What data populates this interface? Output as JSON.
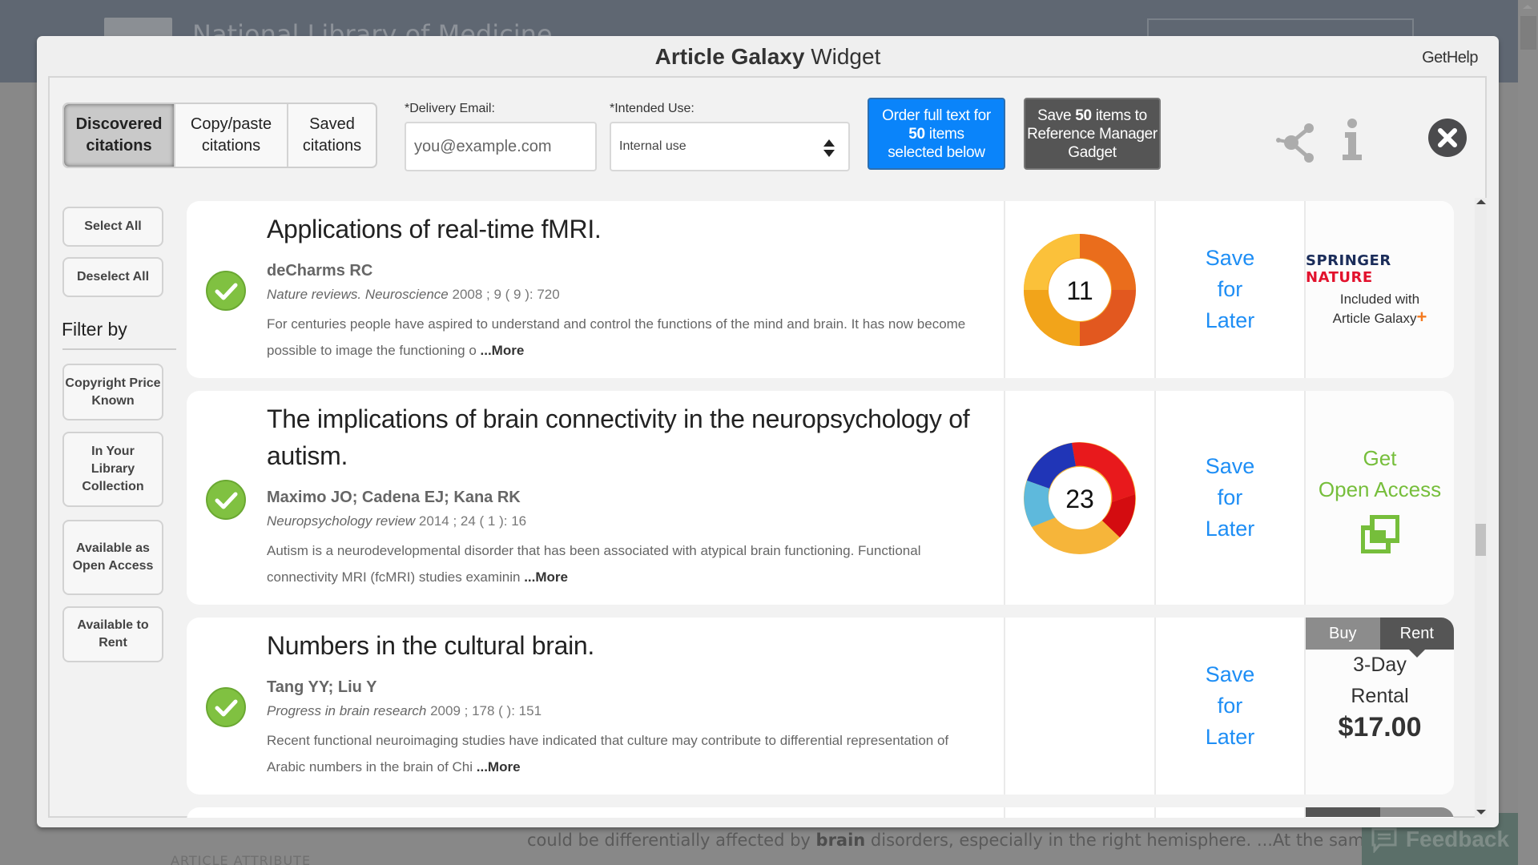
{
  "background_page": {
    "site_title": "National Library of Medicine",
    "text_before_bold": "could be differentially affected by ",
    "text_bold": "brain",
    "text_after_bold": " disorders, especially in the right hemisphere. ...At the same time,",
    "article_attribute": "ARTICLE ATTRIBUTE",
    "feedback_label": "Feedback"
  },
  "modal": {
    "title_brand": "Article Galaxy",
    "title_rest": " Widget",
    "get_help": "GetHelp"
  },
  "tabs": [
    {
      "label": "Discovered citations",
      "active": true
    },
    {
      "label": "Copy/paste citations",
      "active": false
    },
    {
      "label": "Saved citations",
      "active": false
    }
  ],
  "toolbar": {
    "email_label": "*Delivery Email:",
    "email_placeholder": "you@example.com",
    "email_value": "",
    "use_label": "*Intended Use:",
    "use_value": "Internal use",
    "order_pre": "Order full text for",
    "order_count": "50",
    "order_mid": " items",
    "order_post": "selected below",
    "save_pre": "Save ",
    "save_count": "50",
    "save_mid": " items to",
    "save_post": "Reference Manager Gadget",
    "accent_blue": "#0a84fa"
  },
  "sidebar": {
    "select_all": "Select All",
    "deselect_all": "Deselect All",
    "filter_heading": "Filter by",
    "filters": [
      "Copyright Price Known",
      "In Your Library Collection",
      "Available as Open Access",
      "Available to Rent"
    ]
  },
  "articles": [
    {
      "title": "Applications of real-time fMRI.",
      "authors": "deCharms RC",
      "journal": "Nature reviews. Neuroscience",
      "citation": " 2008 ; 9 ( 9 ): 720",
      "abstract": "For centuries people have aspired to understand and control the functions of the mind and brain. It has now become possible to image the functioning o ",
      "more": "...More",
      "selected": true,
      "altmetric_score": "11",
      "save_later": [
        "Save",
        "for",
        "Later"
      ],
      "access": {
        "type": "publisher",
        "publisher_part1": "SPRINGER",
        "publisher_part2": "NATURE",
        "included_line1": "Included with",
        "included_line2": "Article Galaxy"
      }
    },
    {
      "title": "The implications of brain connectivity in the neuropsychology of autism.",
      "authors": "Maximo JO; Cadena EJ; Kana RK",
      "journal": "Neuropsychology review",
      "citation": " 2014 ; 24 ( 1 ): 16",
      "abstract": "Autism is a neurodevelopmental disorder that has been associated with atypical brain functioning. Functional connectivity MRI (fcMRI) studies examinin ",
      "more": "...More",
      "selected": true,
      "altmetric_score": "23",
      "save_later": [
        "Save",
        "for",
        "Later"
      ],
      "access": {
        "type": "open_access",
        "line1": "Get",
        "line2": "Open Access"
      }
    },
    {
      "title": "Numbers in the cultural brain.",
      "authors": "Tang YY; Liu Y",
      "journal": "Progress in brain research",
      "citation": " 2009 ; 178 ( ): 151",
      "abstract": "Recent functional neuroimaging studies have indicated that culture may contribute to differential representation of Arabic numbers in the brain of Chi ",
      "more": "...More",
      "selected": true,
      "altmetric_score": "",
      "save_later": [
        "Save",
        "for",
        "Later"
      ],
      "access": {
        "type": "rent",
        "buy_label": "Buy",
        "rent_label": "Rent",
        "active_option": "Rent",
        "rental_line1": "3-Day",
        "rental_line2": "Rental",
        "price": "$17.00"
      }
    }
  ]
}
